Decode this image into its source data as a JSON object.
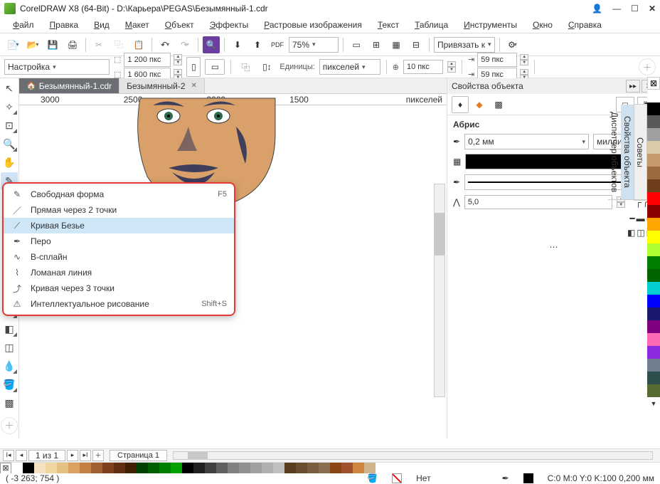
{
  "title": "CorelDRAW X8 (64-Bit) - D:\\Карьера\\PEGAS\\Безымянный-1.cdr",
  "menu": [
    "Файл",
    "Правка",
    "Вид",
    "Макет",
    "Объект",
    "Эффекты",
    "Растровые изображения",
    "Текст",
    "Таблица",
    "Инструменты",
    "Окно",
    "Справка"
  ],
  "toolbar1": {
    "zoom": "75%",
    "snap": "Привязать к"
  },
  "propbar": {
    "labelCombo": "Настройка",
    "dimW": "1 200 пкс",
    "dimH": "1 600 пкс",
    "unitsLabel": "Единицы:",
    "units": "пикселей",
    "nudge": "10 пкс",
    "dupX": "59 пкс",
    "dupY": "59 пкс"
  },
  "tabs": [
    {
      "label": "Безымянный-1.cdr",
      "active": true
    },
    {
      "label": "Безымянный-2",
      "active": false
    }
  ],
  "ruler": {
    "ticks": [
      "3000",
      "2500",
      "2000",
      "1500"
    ],
    "unitLabel": "пикселей"
  },
  "flyout": {
    "items": [
      {
        "icon": "✎",
        "label": "Свободная форма",
        "shortcut": "F5",
        "hi": false
      },
      {
        "icon": "／",
        "label": "Прямая через 2 точки",
        "shortcut": "",
        "hi": false
      },
      {
        "icon": "⟋",
        "label": "Кривая Безье",
        "shortcut": "",
        "hi": true
      },
      {
        "icon": "✒",
        "label": "Перо",
        "shortcut": "",
        "hi": false
      },
      {
        "icon": "∿",
        "label": "В-сплайн",
        "shortcut": "",
        "hi": false
      },
      {
        "icon": "⌇",
        "label": "Ломаная линия",
        "shortcut": "",
        "hi": false
      },
      {
        "icon": "⤴",
        "label": "Кривая через 3 точки",
        "shortcut": "",
        "hi": false
      },
      {
        "icon": "⚠",
        "label": "Интеллектуальное рисование",
        "shortcut": "Shift+S",
        "hi": false
      }
    ]
  },
  "rightPanel": {
    "title": "Свойства объекта",
    "sectionTitle": "Абрис",
    "outlineWidth": "0,2 мм",
    "outlineUnits": "миллиме...",
    "miterValue": "5,0"
  },
  "vtabs": [
    "Советы",
    "Свойства объекта",
    "Диспетчер объектов"
  ],
  "page": {
    "navLabel": "1  из  1",
    "pageTab": "Страница 1"
  },
  "status": {
    "coords": "( -3 263; 754   )",
    "fill": "Нет",
    "outline": "C:0 M:0 Y:0 K:100  0,200 мм"
  },
  "colors": [
    "#ffffff",
    "#000000",
    "#595959",
    "#a0a0a0",
    "#d9cba8",
    "#c49a6c",
    "#9b6b3f",
    "#6e3f1a",
    "#ff0000",
    "#8b0000",
    "#ffa500",
    "#ffff00",
    "#adff2f",
    "#008000",
    "#006400",
    "#00ced1",
    "#0000ff",
    "#191970",
    "#800080",
    "#ff69b4",
    "#8a2be2",
    "#708090",
    "#2f4f4f",
    "#556b2f"
  ],
  "paletteRow": [
    "#ffffff",
    "#000000",
    "#f4e1c1",
    "#f0d5a0",
    "#e6c080",
    "#dca060",
    "#c48040",
    "#a06030",
    "#804020",
    "#603010",
    "#402000",
    "#004000",
    "#006000",
    "#008000",
    "#00a000",
    "#000000",
    "#202020",
    "#404040",
    "#606060",
    "#808080",
    "#909090",
    "#a0a0a0",
    "#b0b0b0",
    "#c0c0c0",
    "#5a3c1e",
    "#6a4c2e",
    "#7a5c3e",
    "#8a6c4e",
    "#8b4513",
    "#a0522d",
    "#cd853f",
    "#d2b48c"
  ]
}
